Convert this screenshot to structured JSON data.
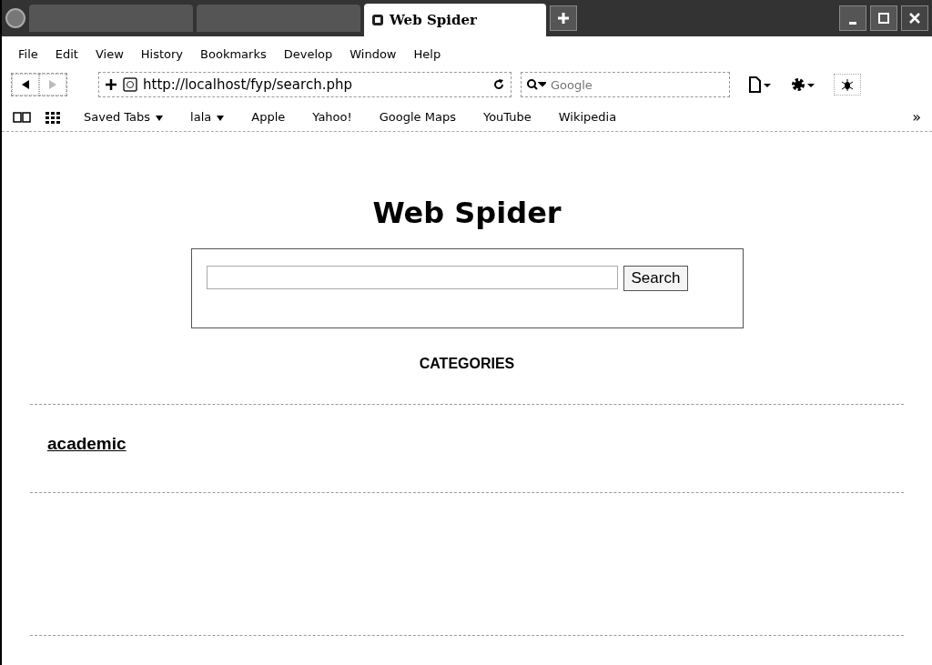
{
  "tabs": [
    {
      "selected": false
    },
    {
      "selected": false
    },
    {
      "label": "Web Spider",
      "selected": true
    }
  ],
  "menu": [
    "File",
    "Edit",
    "View",
    "History",
    "Bookmarks",
    "Develop",
    "Window",
    "Help"
  ],
  "address": {
    "value": "http://localhost/fyp/search.php"
  },
  "search": {
    "placeholder": "Google"
  },
  "bookmarks": [
    {
      "label": "Saved Tabs",
      "dropdown": true
    },
    {
      "label": "lala",
      "dropdown": true
    },
    {
      "label": "Apple",
      "dropdown": false
    },
    {
      "label": "Yahoo!",
      "dropdown": false
    },
    {
      "label": "Google Maps",
      "dropdown": false
    },
    {
      "label": "YouTube",
      "dropdown": false
    },
    {
      "label": "Wikipedia",
      "dropdown": false
    }
  ],
  "overflow": "»",
  "page": {
    "heading": "Web Spider",
    "search_button": "Search",
    "categories_title": "CATEGORIES",
    "categories": [
      "academic"
    ]
  }
}
